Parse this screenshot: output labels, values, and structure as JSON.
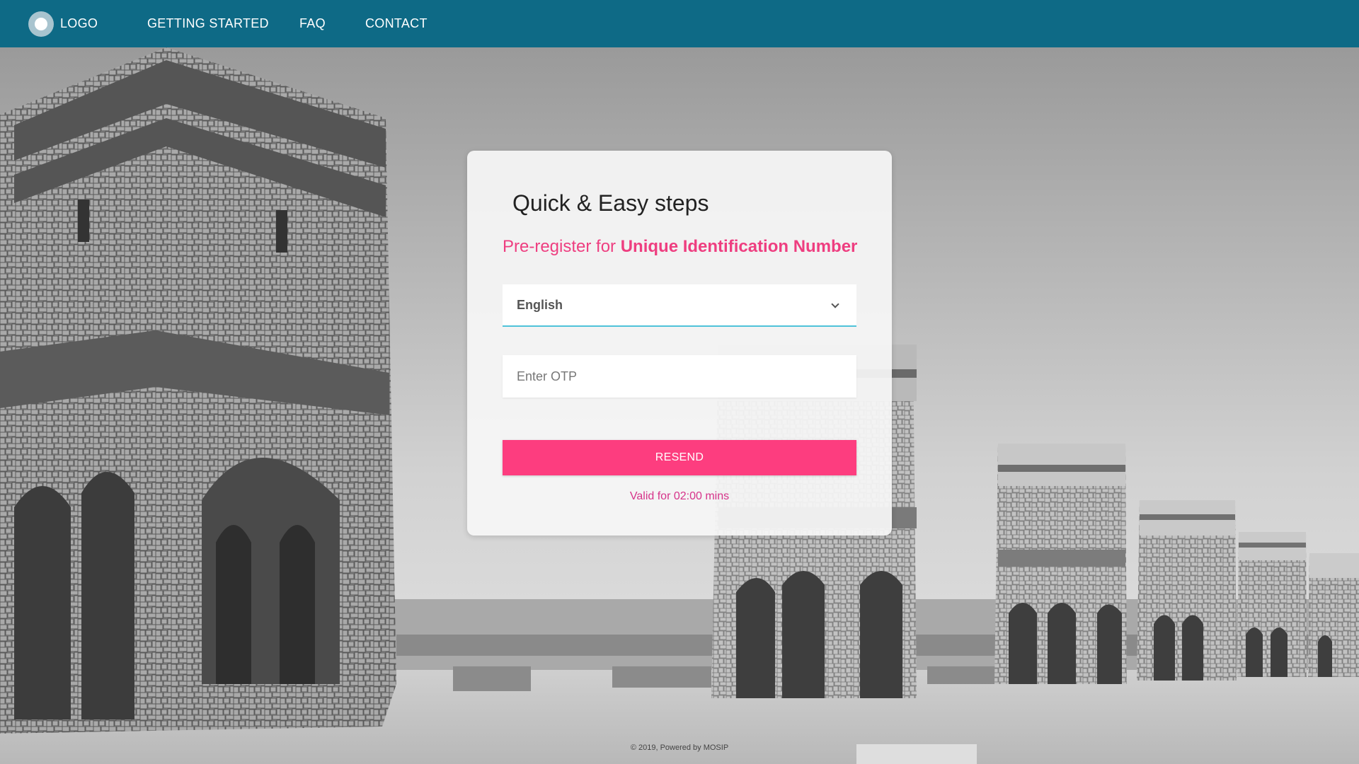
{
  "header": {
    "logo_label": "LOGO",
    "nav": {
      "getting_started": "GETTING STARTED",
      "faq": "FAQ",
      "contact": "CONTACT"
    }
  },
  "card": {
    "title": "Quick & Easy steps",
    "subtitle_prefix": "Pre-register for",
    "subtitle_highlight": "Unique Identification Number",
    "language_select": {
      "value": "English"
    },
    "otp_field": {
      "placeholder": "Enter OTP",
      "value": ""
    },
    "resend_label": "RESEND",
    "validity_text": "Valid for 02:00 mins"
  },
  "footer": {
    "text": "© 2019, Powered by MOSIP"
  },
  "colors": {
    "header": "#0e6a86",
    "accent_pink": "#fd3d7f",
    "subtitle_pink": "#ee3e80",
    "focus_underline": "#4fc3d9"
  },
  "icons": {
    "logo": "logo-circle-icon",
    "select_arrow": "chevron-down-icon"
  }
}
